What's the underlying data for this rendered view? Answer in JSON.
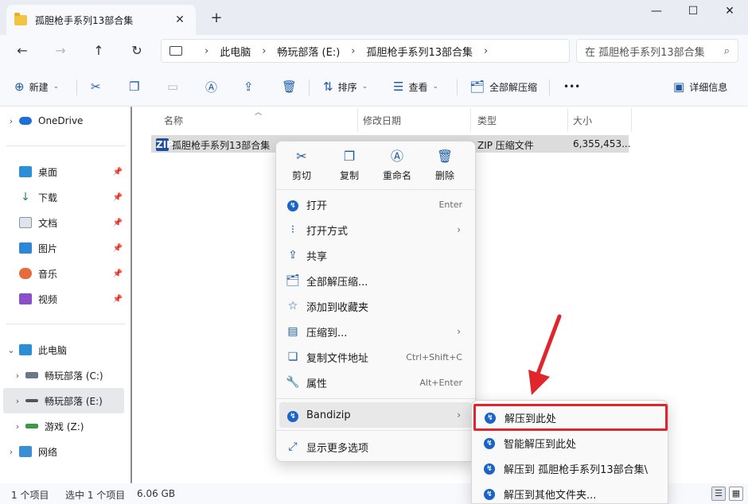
{
  "window": {
    "tab_title": "孤胆枪手系列13部合集",
    "tab_close": "✕",
    "new_tab": "+",
    "min": "—",
    "max": "☐",
    "close": "✕"
  },
  "nav": {
    "back": "←",
    "forward": "→",
    "up": "↑",
    "refresh": "↻",
    "breadcrumbs": [
      "此电脑",
      "畅玩部落 (E:)",
      "孤胆枪手系列13部合集"
    ],
    "search_placeholder": "在 孤胆枪手系列13部合集",
    "search_icon": "⌕"
  },
  "toolbar": {
    "new": "新建",
    "sort": "排序",
    "view": "查看",
    "extract_all": "全部解压缩",
    "more": "•••",
    "details": "详细信息"
  },
  "sidebar": {
    "onedrive": "OneDrive",
    "quick": [
      "桌面",
      "下载",
      "文档",
      "图片",
      "音乐",
      "视频"
    ],
    "this_pc": "此电脑",
    "drives": [
      "畅玩部落 (C:)",
      "畅玩部落 (E:)",
      "游戏 (Z:)"
    ],
    "network": "网络"
  },
  "columns": {
    "name": "名称",
    "modified": "修改日期",
    "type": "类型",
    "size": "大小"
  },
  "file": {
    "name": "孤胆枪手系列13部合集",
    "type": "ZIP 压缩文件",
    "size": "6,355,453...",
    "icon_text": "ZIP"
  },
  "context_menu": {
    "top_actions": [
      "剪切",
      "复制",
      "重命名",
      "删除"
    ],
    "items": [
      {
        "label": "打开",
        "shortcut": "Enter"
      },
      {
        "label": "打开方式",
        "shortcut": ""
      },
      {
        "label": "共享",
        "shortcut": ""
      },
      {
        "label": "全部解压缩...",
        "shortcut": ""
      },
      {
        "label": "添加到收藏夹",
        "shortcut": ""
      },
      {
        "label": "压缩到...",
        "shortcut": ""
      },
      {
        "label": "复制文件地址",
        "shortcut": "Ctrl+Shift+C"
      },
      {
        "label": "属性",
        "shortcut": "Alt+Enter"
      },
      {
        "label": "Bandizip",
        "shortcut": ""
      },
      {
        "label": "显示更多选项",
        "shortcut": ""
      }
    ]
  },
  "submenu": {
    "items": [
      "解压到此处",
      "智能解压到此处",
      "解压到 孤胆枪手系列13部合集\\",
      "解压到其他文件夹..."
    ]
  },
  "status": {
    "count": "1 个项目",
    "selected": "选中 1 个项目",
    "size": "6.06 GB"
  },
  "colors": {
    "highlight_box": "#e0262c",
    "accent": "#1a63c9"
  }
}
